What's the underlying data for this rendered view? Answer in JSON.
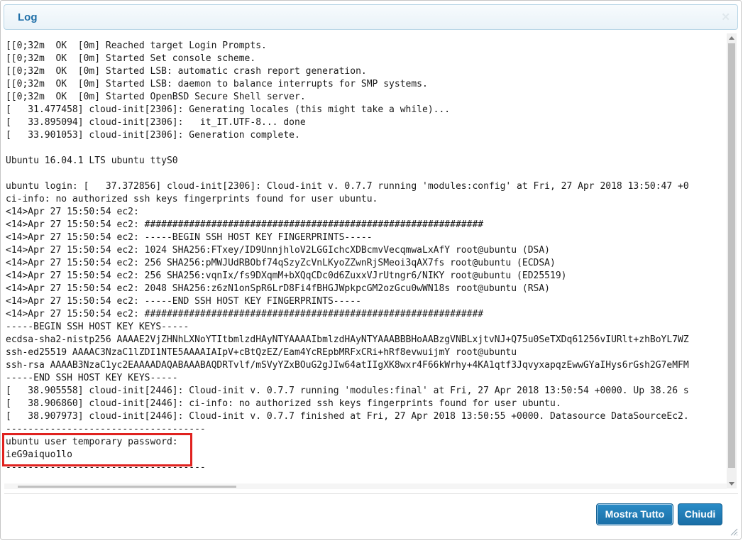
{
  "dialog": {
    "title": "Log",
    "close_icon": "close-icon"
  },
  "log": {
    "lines": [
      "[[0;32m  OK  [0m] Reached target Login Prompts.",
      "[[0;32m  OK  [0m] Started Set console scheme.",
      "[[0;32m  OK  [0m] Started LSB: automatic crash report generation.",
      "[[0;32m  OK  [0m] Started LSB: daemon to balance interrupts for SMP systems.",
      "[[0;32m  OK  [0m] Started OpenBSD Secure Shell server.",
      "[   31.477458] cloud-init[2306]: Generating locales (this might take a while)...",
      "[   33.895094] cloud-init[2306]:   it_IT.UTF-8... done",
      "[   33.901053] cloud-init[2306]: Generation complete.",
      "",
      "Ubuntu 16.04.1 LTS ubuntu ttyS0",
      "",
      "ubuntu login: [   37.372856] cloud-init[2306]: Cloud-init v. 0.7.7 running 'modules:config' at Fri, 27 Apr 2018 13:50:47 +0",
      "ci-info: no authorized ssh keys fingerprints found for user ubuntu.",
      "<14>Apr 27 15:50:54 ec2:",
      "<14>Apr 27 15:50:54 ec2: #############################################################",
      "<14>Apr 27 15:50:54 ec2: -----BEGIN SSH HOST KEY FINGERPRINTS-----",
      "<14>Apr 27 15:50:54 ec2: 1024 SHA256:FTxey/ID9UnnjhloV2LGGIchcXDBcmvVecqmwaLxAfY root@ubuntu (DSA)",
      "<14>Apr 27 15:50:54 ec2: 256 SHA256:pMWJUdRBObf74qSzyZcVnLKyoZZwnRjSMeoi3qAX7fs root@ubuntu (ECDSA)",
      "<14>Apr 27 15:50:54 ec2: 256 SHA256:vqnIx/fs9DXqmM+bXQqCDc0d6ZuxxVJrUtngr6/NIKY root@ubuntu (ED25519)",
      "<14>Apr 27 15:50:54 ec2: 2048 SHA256:z6zN1onSpR6LrD8Fi4fBHGJWpkpcGM2ozGcu0wWN18s root@ubuntu (RSA)",
      "<14>Apr 27 15:50:54 ec2: -----END SSH HOST KEY FINGERPRINTS-----",
      "<14>Apr 27 15:50:54 ec2: #############################################################",
      "-----BEGIN SSH HOST KEY KEYS-----",
      "ecdsa-sha2-nistp256 AAAAE2VjZHNhLXNoYTItbmlzdHAyNTYAAAAIbmlzdHAyNTYAAABBBHoAABzgVNBLxjtvNJ+Q75u0SeTXDq61256vIURlt+zhBoYL7WZ",
      "ssh-ed25519 AAAAC3NzaC1lZDI1NTE5AAAAIAIpV+cBtQzEZ/Eam4YcREpbMRFxCRi+hRf8evwuijmY root@ubuntu",
      "ssh-rsa AAAAB3NzaC1yc2EAAAADAQABAAABAQDRTvlf/mSVyYZxBOuG2gJIw64atIIgXK8wxr4F66kWrhy+4KA1qtf3JqvyxapqzEwwGYaIHys6rGsh2G7eMFM",
      "-----END SSH HOST KEY KEYS-----",
      "[   38.905558] cloud-init[2446]: Cloud-init v. 0.7.7 running 'modules:final' at Fri, 27 Apr 2018 13:50:54 +0000. Up 38.26 s",
      "[   38.906860] cloud-init[2446]: ci-info: no authorized ssh keys fingerprints found for user ubuntu.",
      "[   38.907973] cloud-init[2446]: Cloud-init v. 0.7.7 finished at Fri, 27 Apr 2018 13:50:55 +0000. Datasource DataSourceEc2.",
      "------------------------------------",
      "ubuntu user temporary password:",
      "ieG9aiquo1lo",
      "------------------------------------"
    ]
  },
  "buttons": {
    "show_all": "Mostra Tutto",
    "close": "Chiudi"
  },
  "colors": {
    "accent": "#1f6fa8",
    "button": "#1a6fa6",
    "highlight_border": "#e0221f"
  }
}
